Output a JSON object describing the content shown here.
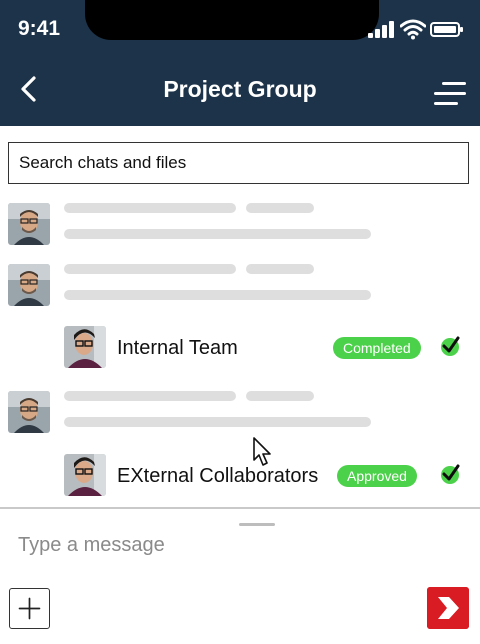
{
  "status_bar": {
    "time": "9:41",
    "icons": [
      "signal-icon",
      "wifi-icon",
      "battery-icon"
    ]
  },
  "header": {
    "title": "Project Group",
    "back_icon": "chevron-left-icon",
    "menu_icon": "menu-icon"
  },
  "search": {
    "placeholder": "Search chats and files"
  },
  "feed": {
    "groups": [
      {
        "name": "Internal Team",
        "status": "Completed",
        "status_icon": "check-circle-icon"
      },
      {
        "name": "EXternal Collaborators",
        "status": "Approved",
        "status_icon": "check-circle-icon"
      }
    ]
  },
  "composer": {
    "placeholder": "Type a message",
    "add_icon": "plus-icon",
    "send_icon": "send-icon"
  },
  "colors": {
    "header_bg": "#1c3349",
    "badge_green": "#4cd14a",
    "send_red": "#d91b24",
    "skeleton": "#dedede"
  }
}
